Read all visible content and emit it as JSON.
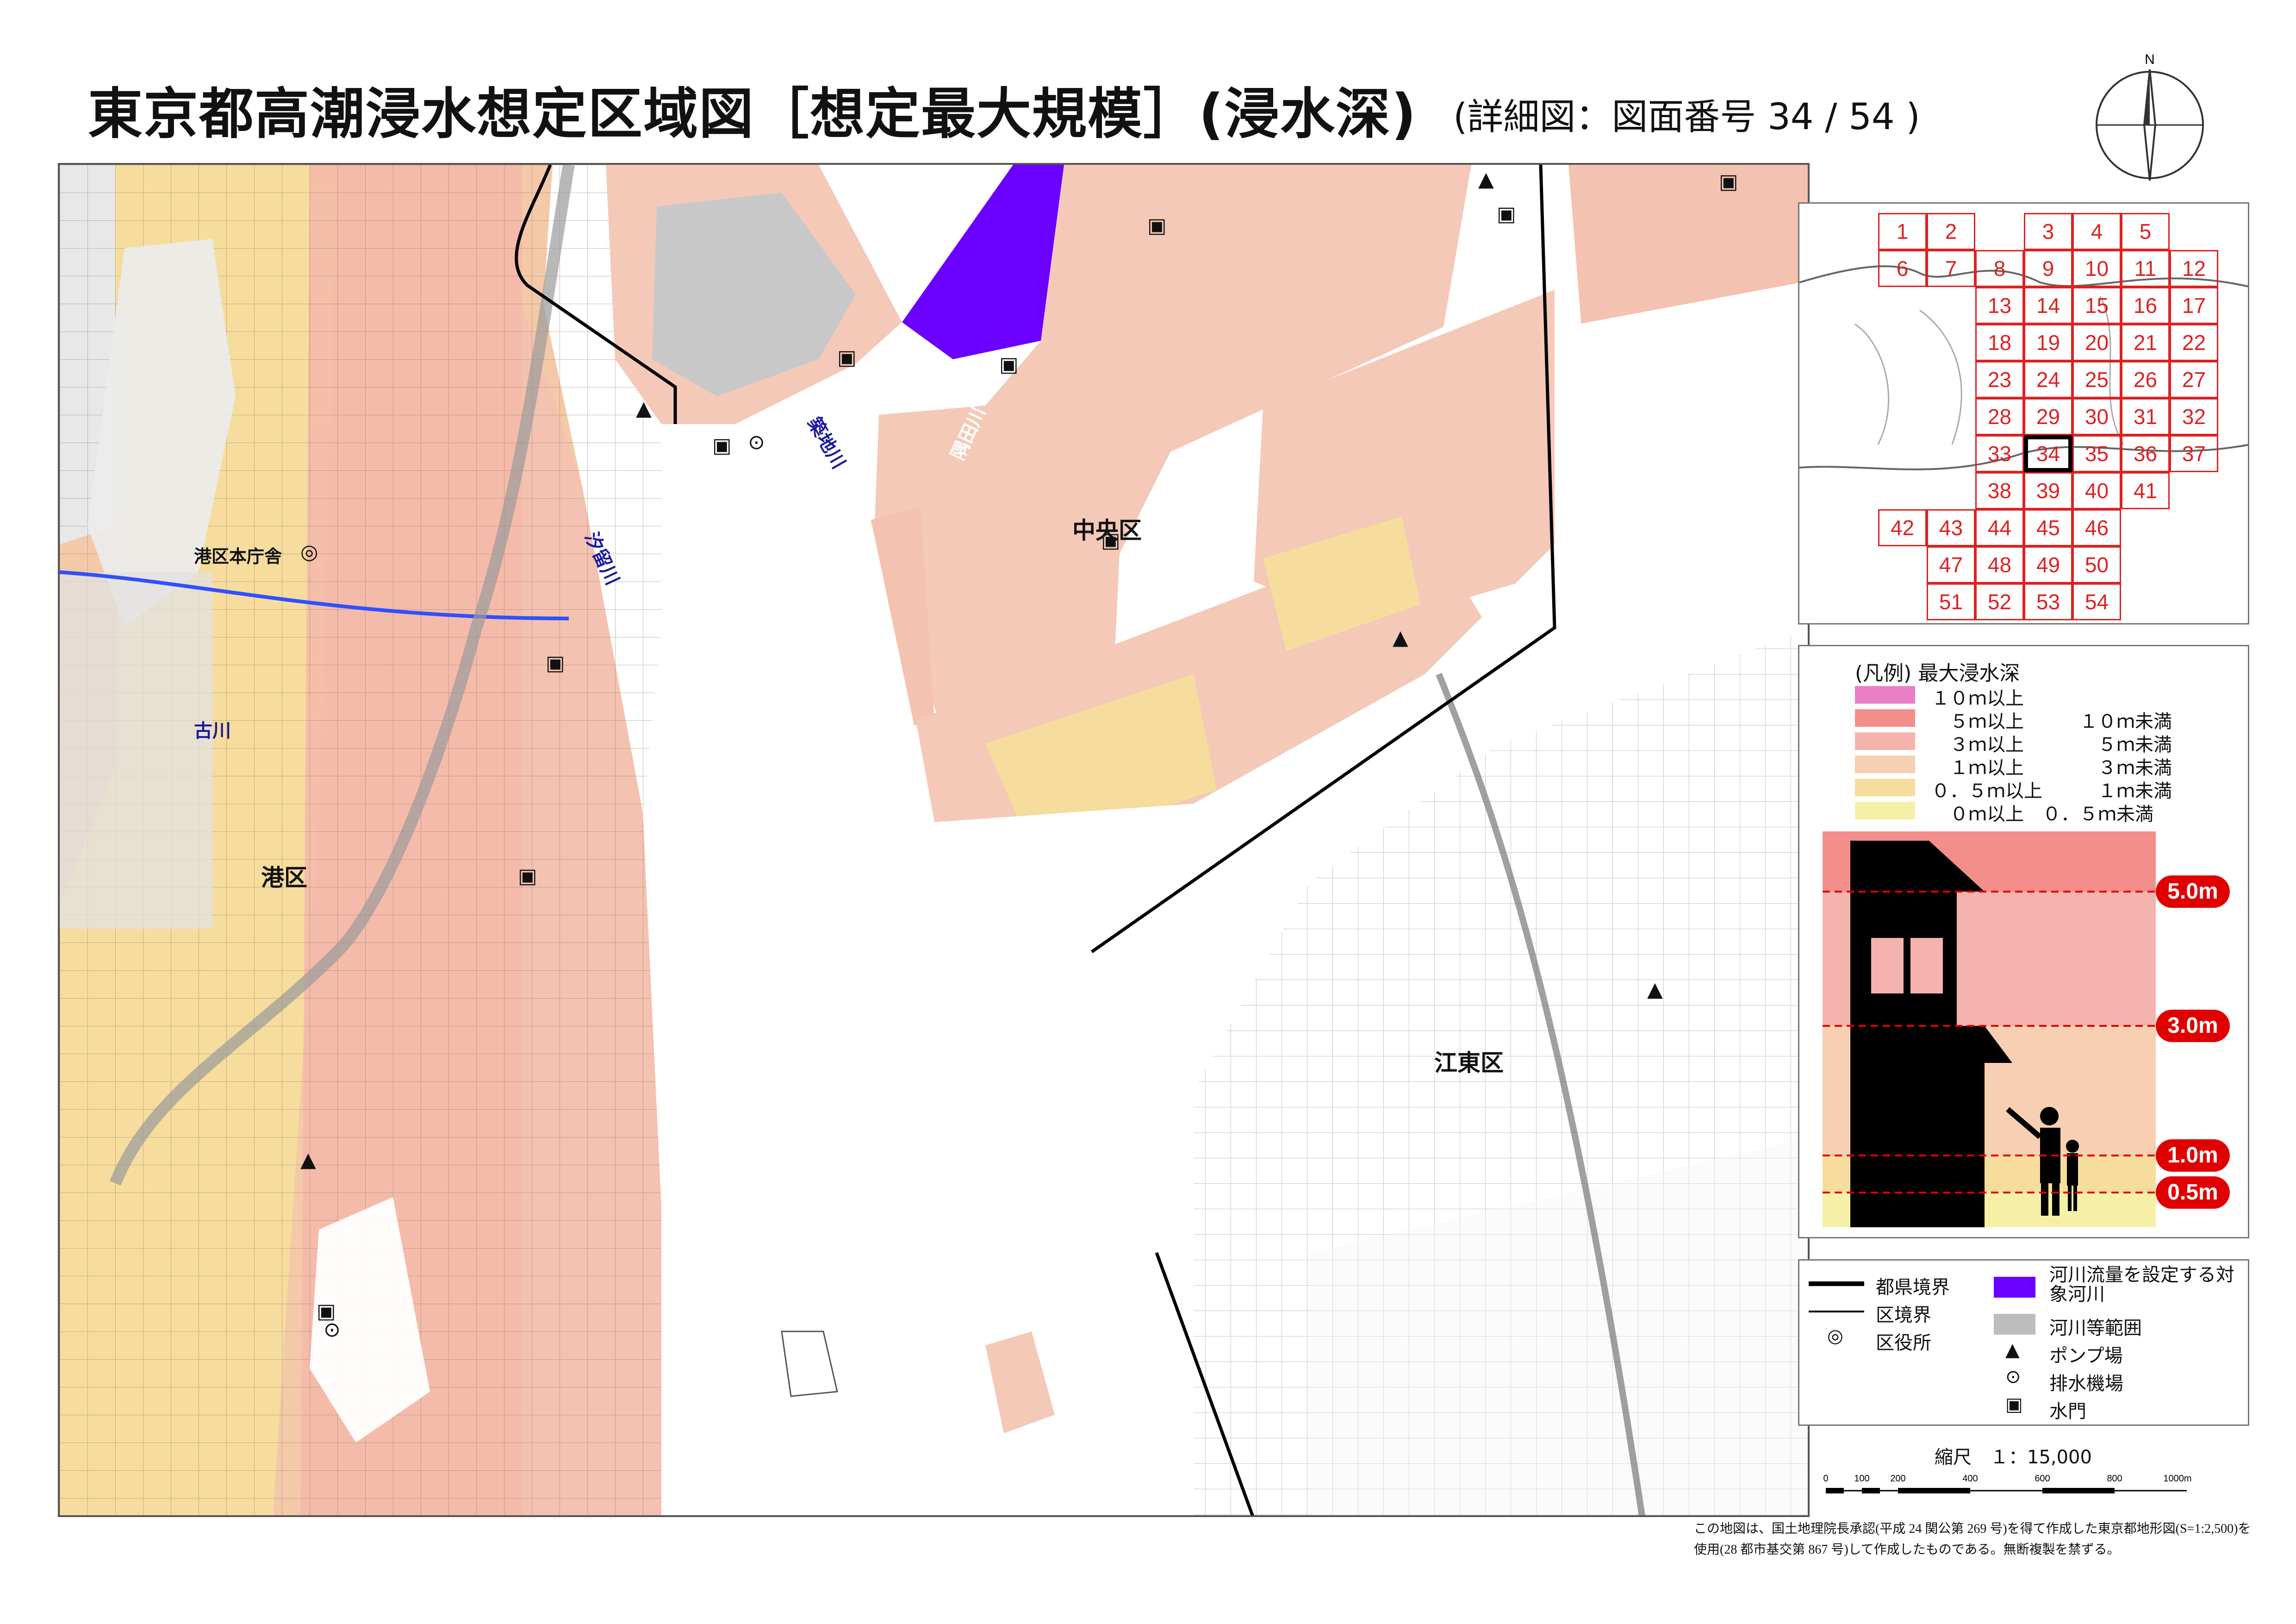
{
  "title": "東京都高潮浸水想定区域図［想定最大規模］(浸水深)",
  "subtitle": "(詳細図：図面番号 34 / 54 )",
  "north_label": "N",
  "map": {
    "wards": [
      "港区",
      "中央区",
      "江東区"
    ],
    "office_label": "港区本庁舎",
    "rivers": [
      "汐留川",
      "築地川",
      "隅田川",
      "古川"
    ],
    "colors": {
      "depth_10m_plus": "#ea7fc7",
      "depth_5_10m": "#f38e8b",
      "depth_3_5m": "#f5b3ad",
      "depth_1_3m": "#f7cfb3",
      "depth_05_1m": "#f6dd9e",
      "depth_0_05m": "#f5f0a6",
      "target_river": "#6a00ff",
      "river_area": "#bdbdbd"
    }
  },
  "index_map": {
    "cells": [
      "1",
      "2",
      "3",
      "4",
      "5",
      "6",
      "7",
      "8",
      "9",
      "10",
      "11",
      "12",
      "13",
      "14",
      "15",
      "16",
      "17",
      "18",
      "19",
      "20",
      "21",
      "22",
      "23",
      "24",
      "25",
      "26",
      "27",
      "28",
      "29",
      "30",
      "31",
      "32",
      "33",
      "34",
      "35",
      "36",
      "37",
      "38",
      "39",
      "40",
      "41",
      "42",
      "43",
      "44",
      "45",
      "46",
      "47",
      "48",
      "49",
      "50",
      "51",
      "52",
      "53",
      "54"
    ],
    "current": "34"
  },
  "legend": {
    "title": "(凡例) 最大浸水深",
    "rows": [
      {
        "label": "１０ｍ以上",
        "color": "#ea7fc7"
      },
      {
        "label": "　５ｍ以上　　　１０ｍ未満",
        "color": "#f38e8b"
      },
      {
        "label": "　３ｍ以上　　　　５ｍ未満",
        "color": "#f5b3ad"
      },
      {
        "label": "　１ｍ以上　　　　３ｍ未満",
        "color": "#f7cfb3"
      },
      {
        "label": "０．５ｍ以上　　　１ｍ未満",
        "color": "#f6dd9e"
      },
      {
        "label": "　０ｍ以上　０．５ｍ未満",
        "color": "#f5f0a6"
      }
    ],
    "depth_marks": [
      "5.0m",
      "3.0m",
      "1.0m",
      "0.5m"
    ]
  },
  "symbols": [
    {
      "icon": "prefecture-boundary-icon",
      "label": "都県境界"
    },
    {
      "icon": "ward-boundary-icon",
      "label": "区境界"
    },
    {
      "icon": "ward-office-icon",
      "label": "区役所"
    },
    {
      "icon": "target-river-icon",
      "label": "河川流量を設定する対象河川"
    },
    {
      "icon": "river-area-icon",
      "label": "河川等範囲"
    },
    {
      "icon": "pump-station-icon",
      "label": "ポンプ場"
    },
    {
      "icon": "drainage-station-icon",
      "label": "排水機場"
    },
    {
      "icon": "floodgate-icon",
      "label": "水門"
    }
  ],
  "scale": {
    "label": "縮尺　１：15,000",
    "ticks": [
      "0",
      "100",
      "200",
      "400",
      "600",
      "800",
      "1000m"
    ]
  },
  "note": {
    "line1": "この地図は、国土地理院長承認(平成 24 関公第 269 号)を得て作成した東京都地形図(S=1:2,500)を",
    "line2": "使用(28 都市基交第 867 号)して作成したものである。無断複製を禁ずる。"
  }
}
